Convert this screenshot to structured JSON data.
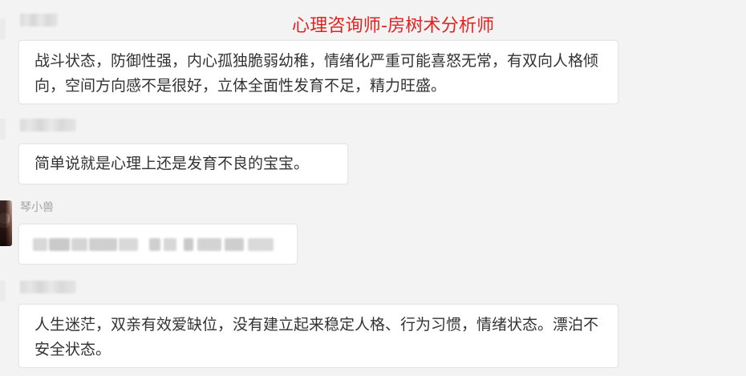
{
  "overlay": {
    "title": "心理咨询师-房树术分析师"
  },
  "messages": [
    {
      "sender": "",
      "text": "战斗状态，防御性强，内心孤独脆弱幼稚，情绪化严重可能喜怒无常，有双向人格倾向，空间方向感不是很好，立体全面性发育不足，精力旺盛。"
    },
    {
      "sender": "",
      "text": "简单说就是心理上还是发育不良的宝宝。"
    },
    {
      "sender": "琴小兽",
      "text": ""
    },
    {
      "sender": "",
      "text": "人生迷茫，双亲有效爱缺位，没有建立起来稳定人格、行为习惯，情绪状态。漂泊不安全状态。"
    }
  ],
  "colors": {
    "background": "#f3f3f3",
    "bubble": "#ffffff",
    "bubble_border": "#e6e6e6",
    "body_text": "#333333",
    "sender_text": "#a4a4a4",
    "overlay_text": "#e2221f"
  }
}
